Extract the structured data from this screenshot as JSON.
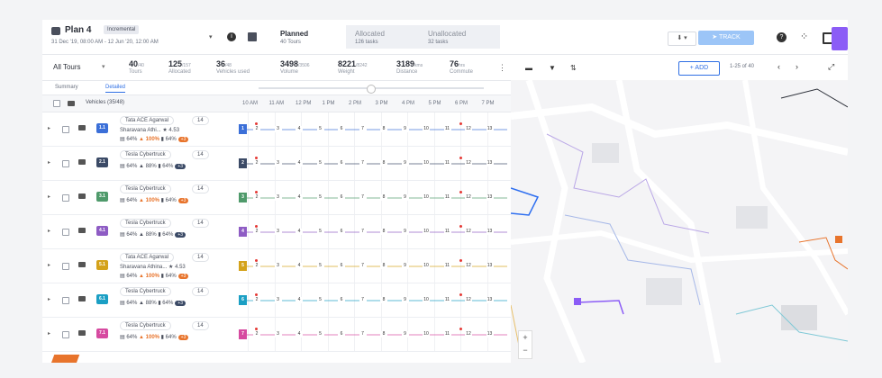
{
  "header": {
    "plan_title": "Plan 4",
    "plan_badge": "Incremental",
    "plan_dates": "31 Dec '19, 08:00 AM - 12 Jun '20, 12:00 AM",
    "tabs": [
      {
        "title": "Planned",
        "subtitle": "40 Tours"
      },
      {
        "title": "Allocated",
        "subtitle": "126 tasks"
      },
      {
        "title": "Unallocated",
        "subtitle": "32 tasks"
      }
    ],
    "track_label": "TRACK"
  },
  "stats": {
    "filter": "All Tours",
    "items": [
      {
        "value": "40",
        "suffix": "/40",
        "label": "Tours"
      },
      {
        "value": "125",
        "suffix": "/157",
        "label": "Allocated"
      },
      {
        "value": "36",
        "suffix": "/48",
        "label": "Vehicles used"
      },
      {
        "value": "3498",
        "suffix": "/3506",
        "label": "Volume"
      },
      {
        "value": "8221",
        "suffix": "/8242",
        "label": "Weight"
      },
      {
        "value": "3189",
        "suffix": "kms",
        "label": "Distance"
      },
      {
        "value": "76",
        "suffix": "hrs",
        "label": "Commute"
      }
    ]
  },
  "subtabs": [
    "Summary",
    "Detailed"
  ],
  "table": {
    "vehicles_header": "Vehicles (35/48)",
    "times": [
      "10 AM",
      "11 AM",
      "12 PM",
      "1 PM",
      "2 PM",
      "3 PM",
      "4 PM",
      "5 PM",
      "6 PM",
      "7 PM"
    ],
    "rows": [
      {
        "badge": "1.1",
        "color": "#3b6fd8",
        "vehicle": "Tata ACE Agarwal",
        "num": "14",
        "driver": "Sharavana Athi...",
        "rating": "4.53",
        "u1": "64%",
        "u2": "100%",
        "u3": "64%",
        "plus": "+3",
        "hot": true
      },
      {
        "badge": "2.1",
        "color": "#3b4a66",
        "vehicle": "Tesla Cybertruck",
        "num": "14",
        "driver": "",
        "rating": "",
        "u1": "64%",
        "u2": "88%",
        "u3": "64%",
        "plus": "+3",
        "hot": false
      },
      {
        "badge": "3.1",
        "color": "#4f9a6b",
        "vehicle": "Tesla Cybertruck",
        "num": "14",
        "driver": "",
        "rating": "",
        "u1": "64%",
        "u2": "100%",
        "u3": "64%",
        "plus": "+3",
        "hot": true
      },
      {
        "badge": "4.1",
        "color": "#8e5cc4",
        "vehicle": "Tesla Cybertruck",
        "num": "14",
        "driver": "",
        "rating": "",
        "u1": "64%",
        "u2": "88%",
        "u3": "64%",
        "plus": "+3",
        "hot": false
      },
      {
        "badge": "5.1",
        "color": "#d4a21a",
        "vehicle": "Tata ACE Agarwal",
        "num": "14",
        "driver": "Sharavana Athina...",
        "rating": "4.53",
        "u1": "64%",
        "u2": "100%",
        "u3": "64%",
        "plus": "+3",
        "hot": true
      },
      {
        "badge": "6.1",
        "color": "#1b9fc4",
        "vehicle": "Tesla Cybertruck",
        "num": "14",
        "driver": "",
        "rating": "",
        "u1": "64%",
        "u2": "88%",
        "u3": "64%",
        "plus": "+3",
        "hot": false
      },
      {
        "badge": "7.1",
        "color": "#d64aa0",
        "vehicle": "Tesla Cybertruck",
        "num": "14",
        "driver": "",
        "rating": "",
        "u1": "64%",
        "u2": "100%",
        "u3": "64%",
        "plus": "+3",
        "hot": true
      }
    ]
  },
  "map_toolbar": {
    "add_label": "+ ADD",
    "paging": "1-25 of 40"
  }
}
